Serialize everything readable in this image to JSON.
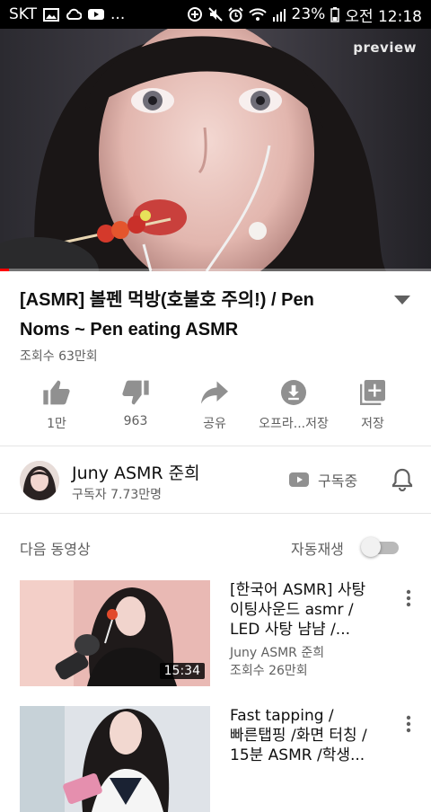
{
  "status_bar": {
    "carrier": "SKT",
    "dots": "...",
    "battery_percent": "23%",
    "time": "오전 12:18"
  },
  "player": {
    "preview_tag": "preview",
    "progress_fraction": 0.02
  },
  "video": {
    "title_line1": "[ASMR] 볼펜 먹방(호불호 주의!) / Pen",
    "title_line2": "Noms ~ Pen eating ASMR",
    "views": "조회수 63만회"
  },
  "actions": [
    {
      "label": "1만",
      "icon": "thumbs-up-icon"
    },
    {
      "label": "963",
      "icon": "thumbs-down-icon"
    },
    {
      "label": "공유",
      "icon": "share-icon"
    },
    {
      "label": "오프라...저장",
      "icon": "download-icon"
    },
    {
      "label": "저장",
      "icon": "add-to-playlist-icon"
    }
  ],
  "channel": {
    "name": "Juny ASMR 준희",
    "subscribers": "구독자 7.73만명",
    "subscribe_label": "구독중"
  },
  "up_next": {
    "label": "다음 동영상",
    "autoplay_label": "자동재생",
    "autoplay_on": false
  },
  "videos": [
    {
      "title_lines": [
        "[한국어 ASMR] 사탕",
        "이팅사운드 asmr /",
        "LED 사탕 냠냠 /..."
      ],
      "channel": "Juny ASMR 준희",
      "views": "조회수 26만회",
      "duration": "15:34"
    },
    {
      "title_lines": [
        "Fast tapping /",
        "빠른탭핑 /화면 터칭 /",
        "15분 ASMR /학생..."
      ],
      "channel": "",
      "views": "",
      "duration": ""
    }
  ],
  "colors": {
    "accent": "#ff0000",
    "text_primary": "#0f0f0f",
    "text_secondary": "#606060",
    "icon_gray": "#909090"
  }
}
